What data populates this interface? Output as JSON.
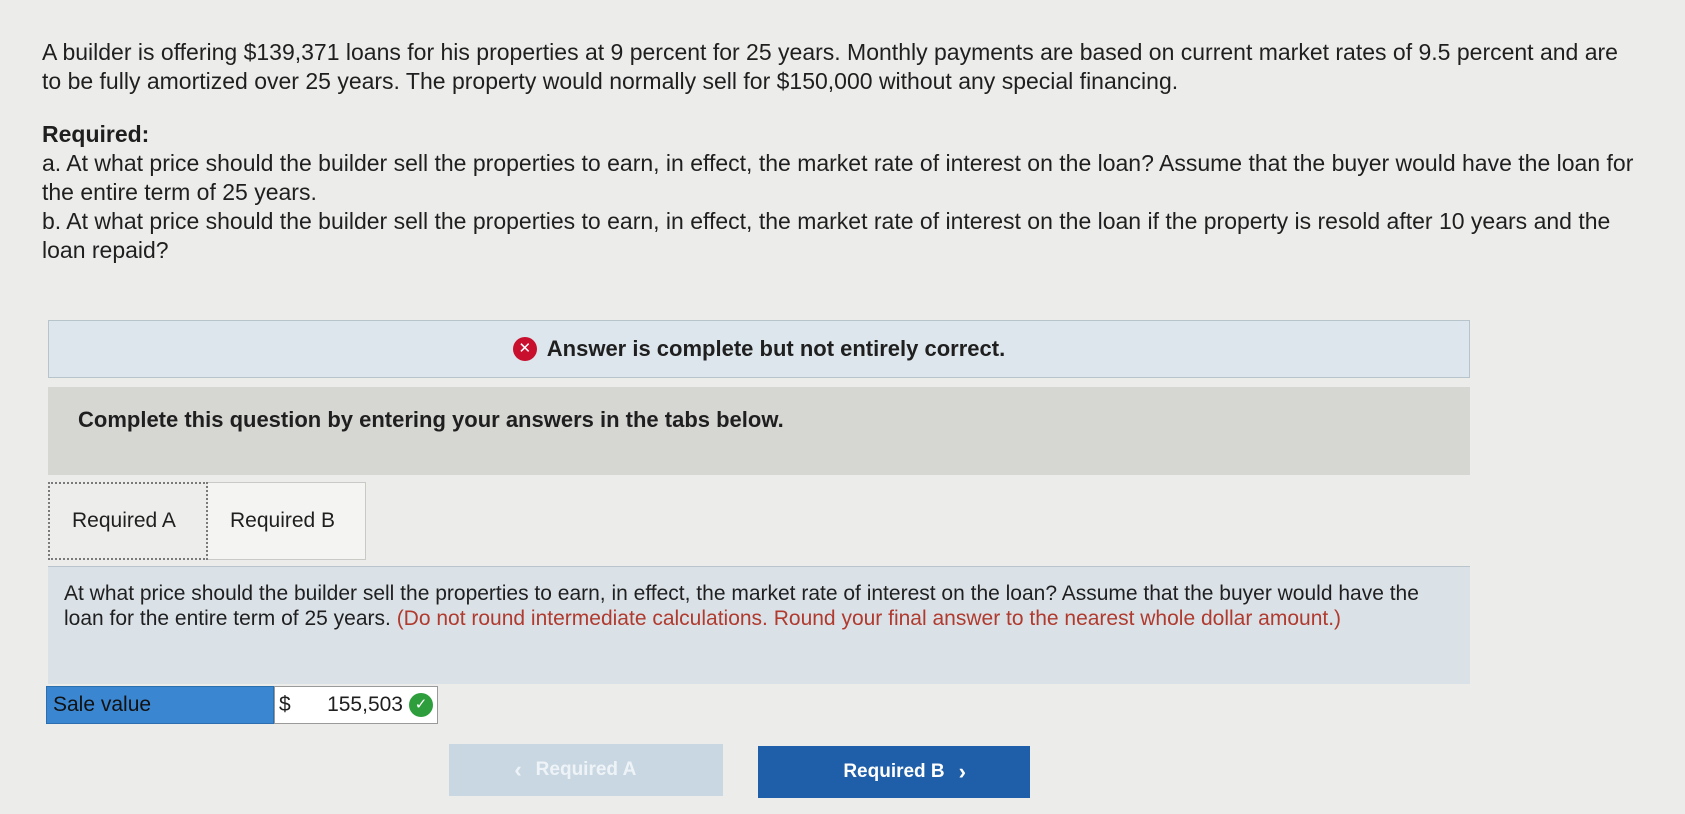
{
  "question": {
    "intro": "A builder is offering $139,371 loans for his properties at 9 percent for 25 years. Monthly payments are based on current market rates of 9.5 percent and are to be fully amortized over 25 years. The property would normally sell for $150,000 without any special financing.",
    "required_heading": "Required:",
    "part_a": "a. At what price should the builder sell the properties to earn, in effect, the market rate of interest on the loan? Assume that the buyer would have the loan for the entire term of 25 years.",
    "part_b": "b. At what price should the builder sell the properties to earn, in effect, the market rate of interest on the loan if the property is resold after 10 years and the loan repaid?"
  },
  "banner": {
    "icon": "x-circle-icon",
    "text": "Answer is complete but not entirely correct."
  },
  "instructions": "Complete this question by entering your answers in the tabs below.",
  "tabs": [
    {
      "label": "Required A",
      "active": true
    },
    {
      "label": "Required B",
      "active": false
    }
  ],
  "panel": {
    "prompt": "At what price should the builder sell the properties to earn, in effect, the market rate of interest on the loan? Assume that the buyer would have the loan for the entire term of 25 years.",
    "note": "(Do not round intermediate calculations. Round your final answer to the nearest whole dollar amount.)"
  },
  "answer": {
    "label": "Sale value",
    "currency": "$",
    "value": "155,503",
    "status_icon": "check-circle-icon"
  },
  "nav": {
    "prev_label": "Required A",
    "next_label": "Required B",
    "prev_chevron": "‹",
    "next_chevron": "›"
  },
  "colors": {
    "error": "#c8102e",
    "correct": "#2e9e3d",
    "primary_button": "#1f5ea8",
    "answer_label_bg": "#3a86d1"
  }
}
